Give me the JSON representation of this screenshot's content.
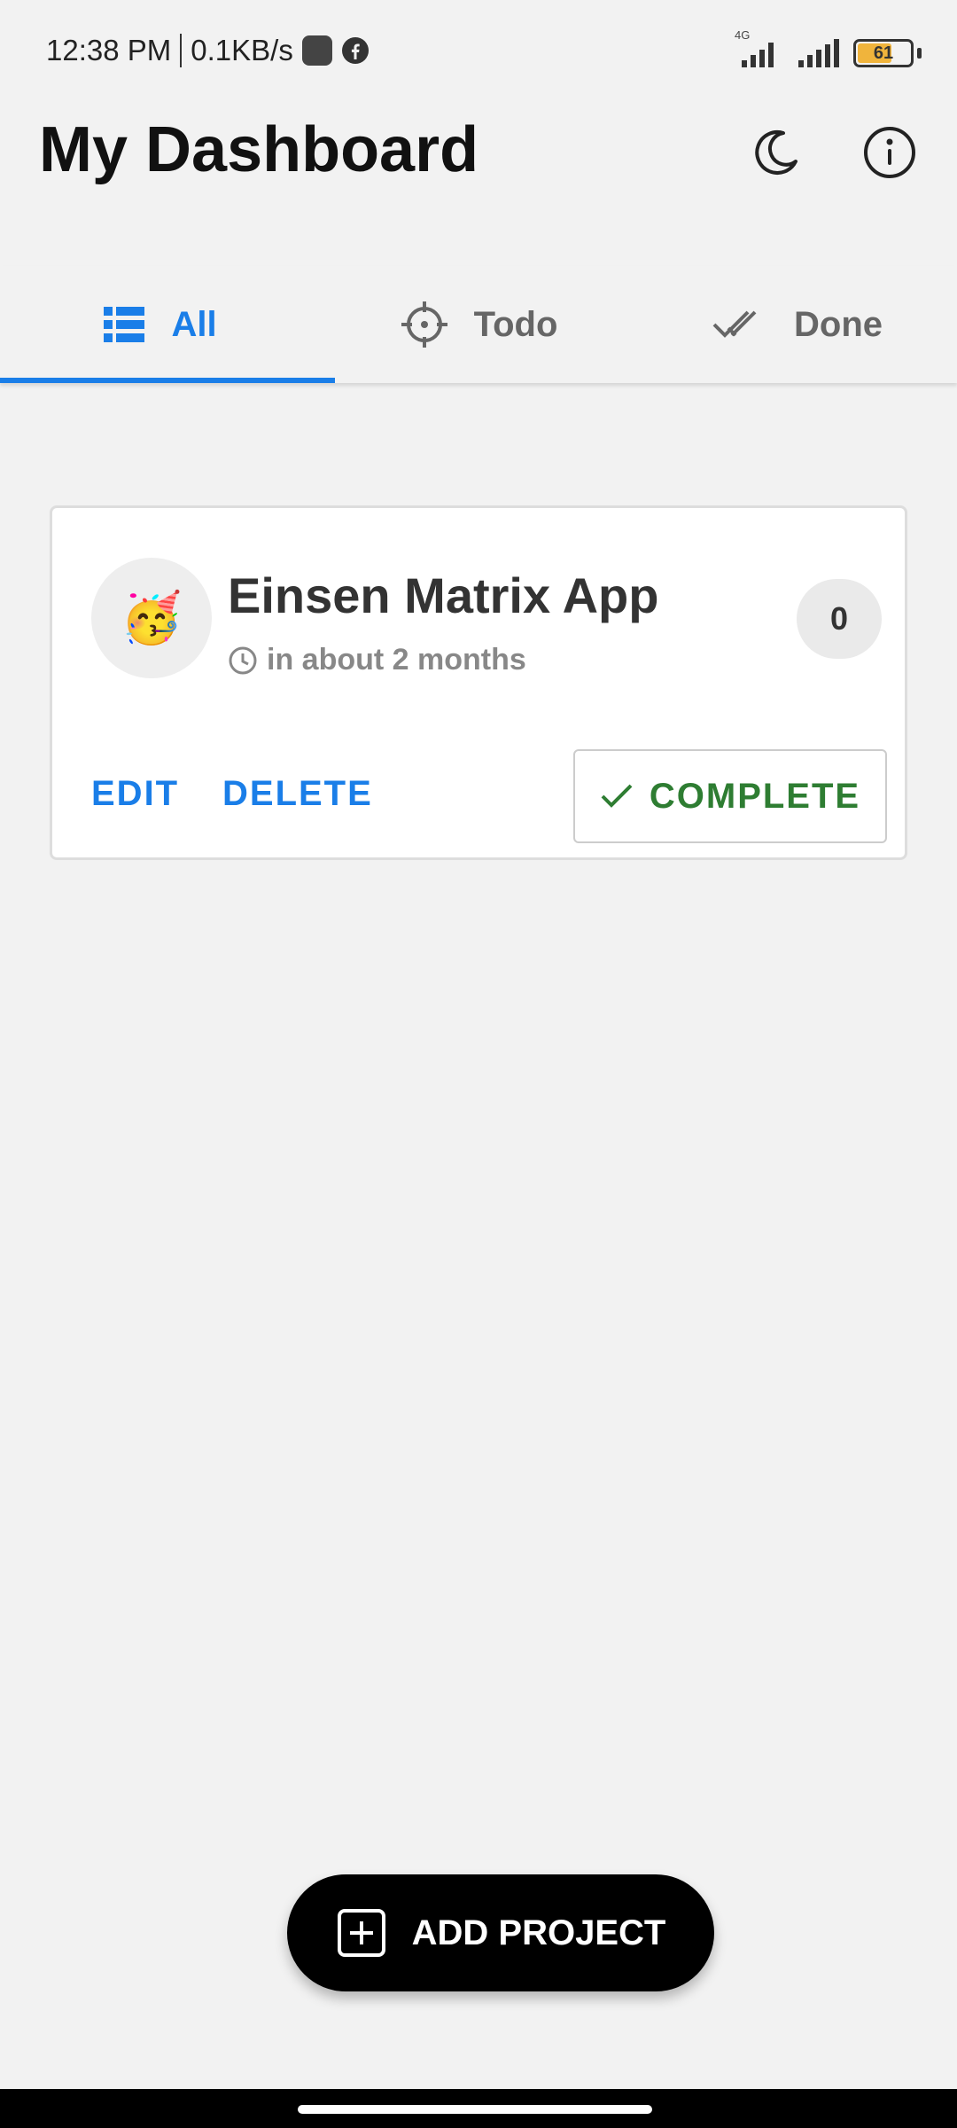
{
  "status_bar": {
    "time": "12:38 PM",
    "speed": "0.1KB/s",
    "network_label": "4G",
    "battery": "61",
    "battery_level": 0.61,
    "icons": [
      "notification-square-icon",
      "facebook-icon",
      "signal-4g-icon",
      "signal-icon",
      "battery-icon"
    ]
  },
  "header": {
    "title": "My Dashboard",
    "icons": [
      "moon-icon",
      "info-icon"
    ]
  },
  "tabs": [
    {
      "label": "All",
      "icon": "list-icon",
      "active": true
    },
    {
      "label": "Todo",
      "icon": "crosshair-icon",
      "active": false
    },
    {
      "label": "Done",
      "icon": "double-check-icon",
      "active": false
    }
  ],
  "project": {
    "emoji": "🥳",
    "title": "Einsen Matrix App",
    "due": "in about 2 months",
    "count": "0",
    "edit_label": "EDIT",
    "delete_label": "DELETE",
    "complete_label": "COMPLETE"
  },
  "fab": {
    "label": "ADD PROJECT",
    "icon": "plus-square-icon"
  },
  "colors": {
    "accent": "#1a7ee8",
    "complete": "#2e7d32",
    "background": "#f2f2f2"
  }
}
